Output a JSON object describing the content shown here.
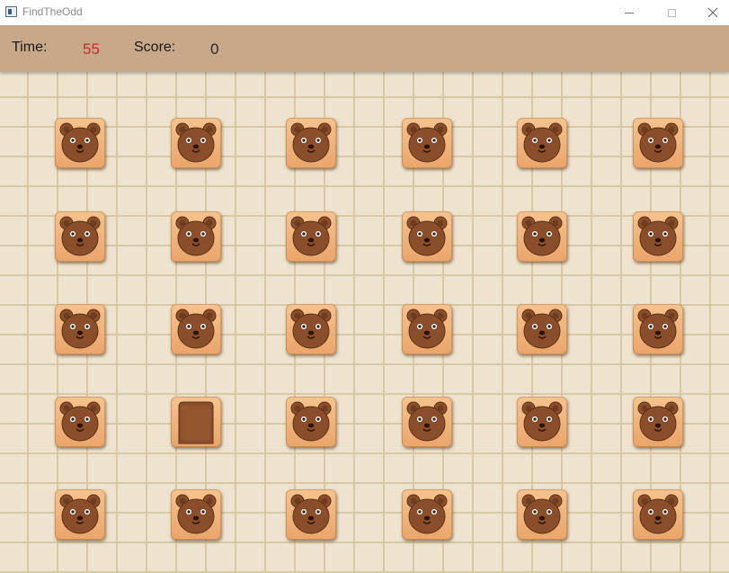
{
  "window": {
    "title": "FindTheOdd",
    "minimize_icon": "minimize-icon",
    "maximize_icon": "maximize-icon",
    "close_icon": "close-icon"
  },
  "hud": {
    "time_label": "Time:",
    "time_value": "55",
    "score_label": "Score:",
    "score_value": "0",
    "time_color": "#b8322a"
  },
  "board": {
    "columns": 6,
    "rows": 5,
    "tiles": [
      [
        "bear",
        "bear",
        "bear",
        "bear",
        "bear",
        "bear"
      ],
      [
        "bear",
        "bear",
        "bear",
        "bear",
        "bear",
        "bear"
      ],
      [
        "bear",
        "bear",
        "bear",
        "bear",
        "bear",
        "bear"
      ],
      [
        "bear",
        "odd-brown-square",
        "bear",
        "bear",
        "bear",
        "bear"
      ],
      [
        "bear",
        "bear",
        "bear",
        "bear",
        "bear",
        "bear"
      ]
    ]
  },
  "colors": {
    "tile_bg": "#f0b37a",
    "bear_face": "#8a4f2a",
    "board_bg": "#ede3cf",
    "hud_bg": "#c8a888"
  }
}
